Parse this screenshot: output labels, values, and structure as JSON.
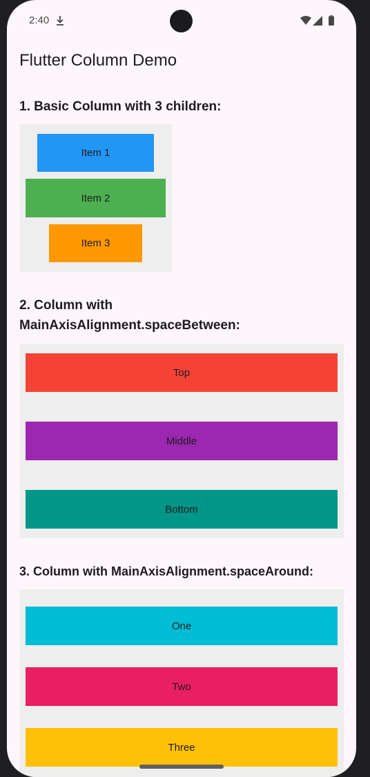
{
  "status_bar": {
    "time": "2:40",
    "icons": [
      "download-icon",
      "wifi-icon",
      "signal-icon",
      "battery-icon"
    ]
  },
  "app": {
    "title": "Flutter Column Demo"
  },
  "sections": [
    {
      "heading": "1. Basic Column with 3 children:",
      "items": [
        {
          "label": "Item 1",
          "color": "#2196f3"
        },
        {
          "label": "Item 2",
          "color": "#4caf50"
        },
        {
          "label": "Item 3",
          "color": "#ff9800"
        }
      ]
    },
    {
      "heading": "2. Column with MainAxisAlignment.spaceBetween:",
      "items": [
        {
          "label": "Top",
          "color": "#f44336"
        },
        {
          "label": "Middle",
          "color": "#9c27b0"
        },
        {
          "label": "Bottom",
          "color": "#009688"
        }
      ]
    },
    {
      "heading": "3. Column with MainAxisAlignment.spaceAround:",
      "items": [
        {
          "label": "One",
          "color": "#00bcd4"
        },
        {
          "label": "Two",
          "color": "#e91e63"
        },
        {
          "label": "Three",
          "color": "#ffc107"
        }
      ]
    }
  ],
  "colors": {
    "background": "#fdf7fc",
    "panel": "#eeeeee",
    "text": "#1d1b20"
  }
}
